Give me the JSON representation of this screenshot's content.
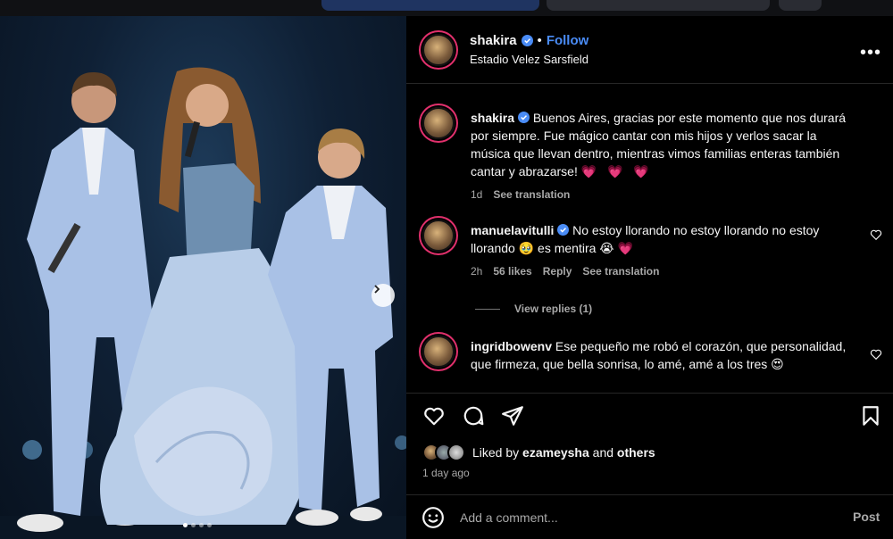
{
  "post": {
    "username": "shakira",
    "follow_label": "Follow",
    "separator": "•",
    "location": "Estadio Velez Sarsfield",
    "more_icon": "more-horizontal-icon"
  },
  "caption": {
    "username": "shakira",
    "text": "Buenos Aires, gracias por este momento que nos durará por siempre. Fue mágico cantar con mis hijos y verlos sacar la música que llevan dentro, mientras vimos familias enteras también cantar y abrazarse!",
    "emoji": "💗 💗 💗",
    "time": "1d",
    "see_translation": "See translation"
  },
  "comments": [
    {
      "username": "manuelavitulli",
      "text": "No estoy llorando no estoy llorando no estoy llorando",
      "emoji1": "🥹",
      "text2": "es mentira",
      "emoji2": "😭  💗",
      "time": "2h",
      "likes": "56 likes",
      "reply": "Reply",
      "see_translation": "See translation",
      "view_replies": "View replies (1)"
    },
    {
      "username": "ingridbowenv",
      "text": "Ese pequeño me robó el corazón, que personalidad, que firmeza, que bella sonrisa, lo amé, amé a los tres",
      "emoji": "😍"
    }
  ],
  "likes": {
    "prefix": "Liked by",
    "user": "ezameysha",
    "and": "and",
    "others": "others",
    "time_ago": "1 day ago"
  },
  "composer": {
    "placeholder": "Add a comment...",
    "post_label": "Post"
  },
  "colors": {
    "accent": "#4a8cf6",
    "heart": "#ff3040",
    "panel_bg": "#000000"
  }
}
